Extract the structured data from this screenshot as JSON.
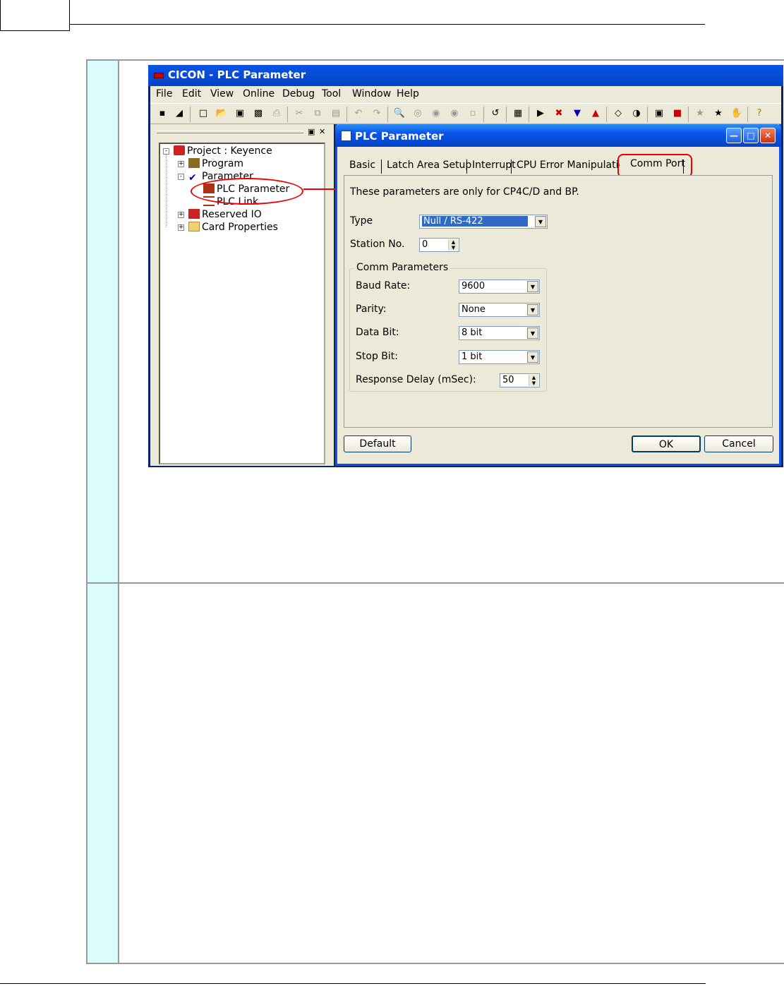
{
  "app": {
    "title": "CICON - PLC Parameter",
    "menu": [
      "File",
      "Edit",
      "View",
      "Online",
      "Debug",
      "Tool",
      "Window",
      "Help"
    ]
  },
  "tree": {
    "items": [
      {
        "label": "Project : Keyence"
      },
      {
        "label": "Program"
      },
      {
        "label": "Parameter"
      },
      {
        "label": "PLC Parameter"
      },
      {
        "label": "PLC Link"
      },
      {
        "label": "Reserved IO"
      },
      {
        "label": "Card Properties"
      }
    ]
  },
  "dialog": {
    "title": "PLC Parameter",
    "tabs": [
      "Basic",
      "Latch Area Setup",
      "Interrupt",
      "CPU Error Manipulation",
      "Comm Port"
    ],
    "active_tab": "Comm Port",
    "note": "These parameters are only for CP4C/D and BP.",
    "type_label": "Type",
    "type_value": "Null / RS-422",
    "station_label": "Station No.",
    "station_value": "0",
    "group_label": "Comm Parameters",
    "baud_label": "Baud Rate:",
    "baud_value": "9600",
    "parity_label": "Parity:",
    "parity_value": "None",
    "databit_label": "Data Bit:",
    "databit_value": "8 bit",
    "stopbit_label": "Stop Bit:",
    "stopbit_value": "1 bit",
    "delay_label": "Response Delay (mSec):",
    "delay_value": "50",
    "default_button": "Default",
    "ok_button": "OK",
    "cancel_button": "Cancel"
  },
  "colors": {
    "highlight": "#e00000",
    "side_column": "#dbfdfe",
    "dialog_bg": "#ece9d8",
    "title_blue": "#0a54e8"
  }
}
